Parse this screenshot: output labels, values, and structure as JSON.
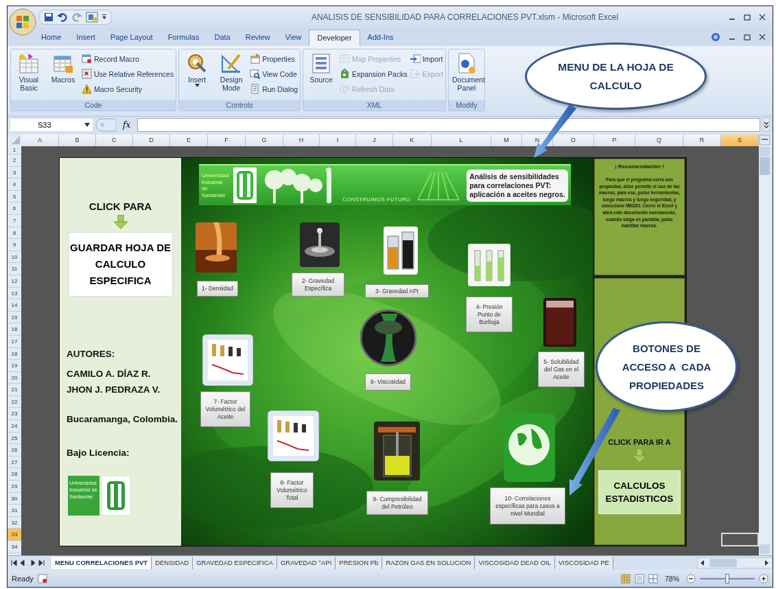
{
  "window": {
    "title": "ANALISIS DE SENSIBILIDAD PARA CORRELACIONES PVT.xlsm - Microsoft Excel"
  },
  "ribbon_tabs": [
    {
      "label": "Home",
      "selected": false
    },
    {
      "label": "Insert",
      "selected": false
    },
    {
      "label": "Page Layout",
      "selected": false
    },
    {
      "label": "Formulas",
      "selected": false
    },
    {
      "label": "Data",
      "selected": false
    },
    {
      "label": "Review",
      "selected": false
    },
    {
      "label": "View",
      "selected": false
    },
    {
      "label": "Developer",
      "selected": true
    },
    {
      "label": "Add-Ins",
      "selected": false
    }
  ],
  "ribbon_groups": [
    {
      "label": "Code",
      "items": [
        {
          "label": "Visual Basic",
          "kind": "large"
        },
        {
          "label": "Macros",
          "kind": "large"
        },
        {
          "label": "Record Macro",
          "kind": "small",
          "disabled": false
        },
        {
          "label": "Use Relative References",
          "kind": "small",
          "disabled": false
        },
        {
          "label": "Macro Security",
          "kind": "small",
          "disabled": false
        }
      ]
    },
    {
      "label": "Controls",
      "items": [
        {
          "label": "Insert",
          "kind": "dropdown"
        },
        {
          "label": "Design Mode",
          "kind": "large"
        },
        {
          "label": "Properties",
          "kind": "small",
          "disabled": false
        },
        {
          "label": "View Code",
          "kind": "small",
          "disabled": false
        },
        {
          "label": "Run Dialog",
          "kind": "small",
          "disabled": false
        }
      ]
    },
    {
      "label": "XML",
      "items": [
        {
          "label": "Source",
          "kind": "large"
        },
        {
          "label": "Map Properties",
          "kind": "small",
          "disabled": true
        },
        {
          "label": "Expansion Packs",
          "kind": "small",
          "disabled": false
        },
        {
          "label": "Refresh Data",
          "kind": "small",
          "disabled": true
        },
        {
          "label": "Import",
          "kind": "small",
          "disabled": false
        },
        {
          "label": "Export",
          "kind": "small",
          "disabled": true
        }
      ]
    },
    {
      "label": "Modify",
      "items": [
        {
          "label": "Document Panel",
          "kind": "large"
        }
      ]
    }
  ],
  "formula_bar": {
    "name_box": "S33",
    "function_label": "fx"
  },
  "columns": [
    {
      "label": "A",
      "selected": false
    },
    {
      "label": "B",
      "selected": false
    },
    {
      "label": "C",
      "selected": false
    },
    {
      "label": "D",
      "selected": false
    },
    {
      "label": "E",
      "selected": false
    },
    {
      "label": "F",
      "selected": false
    },
    {
      "label": "G",
      "selected": false
    },
    {
      "label": "H",
      "selected": false
    },
    {
      "label": "I",
      "selected": false
    },
    {
      "label": "J",
      "selected": false
    },
    {
      "label": "K",
      "selected": false
    },
    {
      "label": "L",
      "selected": false
    },
    {
      "label": "M",
      "selected": false
    },
    {
      "label": "N",
      "selected": false
    },
    {
      "label": "O",
      "selected": false
    },
    {
      "label": "P",
      "selected": false
    },
    {
      "label": "Q",
      "selected": false
    },
    {
      "label": "R",
      "selected": false
    },
    {
      "label": "S",
      "selected": true
    }
  ],
  "rows": [
    {
      "label": "1",
      "selected": false
    },
    {
      "label": "2",
      "selected": false
    },
    {
      "label": "3",
      "selected": false
    },
    {
      "label": "4",
      "selected": false
    },
    {
      "label": "5",
      "selected": false
    },
    {
      "label": "6",
      "selected": false
    },
    {
      "label": "7",
      "selected": false
    },
    {
      "label": "8",
      "selected": false
    },
    {
      "label": "9",
      "selected": false
    },
    {
      "label": "10",
      "selected": false
    },
    {
      "label": "11",
      "selected": false
    },
    {
      "label": "12",
      "selected": false
    },
    {
      "label": "13",
      "selected": false
    },
    {
      "label": "14",
      "selected": false
    },
    {
      "label": "15",
      "selected": false
    },
    {
      "label": "16",
      "selected": false
    },
    {
      "label": "17",
      "selected": false
    },
    {
      "label": "18",
      "selected": false
    },
    {
      "label": "19",
      "selected": false
    },
    {
      "label": "20",
      "selected": false
    },
    {
      "label": "21",
      "selected": false
    },
    {
      "label": "22",
      "selected": false
    },
    {
      "label": "23",
      "selected": false
    },
    {
      "label": "24",
      "selected": false
    },
    {
      "label": "25",
      "selected": false
    },
    {
      "label": "26",
      "selected": false
    },
    {
      "label": "27",
      "selected": false
    },
    {
      "label": "28",
      "selected": false
    },
    {
      "label": "29",
      "selected": false
    },
    {
      "label": "30",
      "selected": false
    },
    {
      "label": "31",
      "selected": false
    },
    {
      "label": "32",
      "selected": false
    },
    {
      "label": "33",
      "selected": true
    },
    {
      "label": "34",
      "selected": false
    }
  ],
  "left_panel": {
    "click_label": "CLICK PARA",
    "save_button": "GUARDAR HOJA DE CALCULO ESPECIFICA",
    "authors_heading": "AUTORES:",
    "authors": [
      "CAMILO A. DÍAZ R.",
      "JHON J. PEDRAZA V."
    ],
    "location": "Bucaramanga, Colombia.",
    "license": "Bajo Licencia:",
    "logo_text": "Universidad Industrial de Santander"
  },
  "banner": {
    "university": "Universidad Industrial de Santander",
    "motto": "CONSTRUIMOS FUTURO",
    "title": "Análisis de sensibilidades para correlaciones PVT: aplicación a aceites negros."
  },
  "property_buttons": [
    {
      "label": "1- Densidad"
    },
    {
      "label": "2- Gravedad Específica"
    },
    {
      "label": "3- Gravedad API"
    },
    {
      "label": "4- Presión Punto de Burbuja"
    },
    {
      "label": "5- Solubilidad del Gas en el Aceite"
    },
    {
      "label": "6- Viscosidad"
    },
    {
      "label": "7- Factor Volumétrico del Aceite"
    },
    {
      "label": "8- Factor Volumétrico Total"
    },
    {
      "label": "9- Compresibilidad del Petróleo"
    },
    {
      "label": "10- Correlaciones específicas para casos a nivel Mundial"
    }
  ],
  "recommendation": {
    "title": "¡ Recomendación !",
    "text": "Para que el programa corra con propiedad, debe permitir el uso de las macros, para eso, pulse herramientas, luego macros y luego seguridad, y seleccione MEDIO. Cierre el Excel y abra este documento nuevamente, cuando salga en pantalla, pulse habilitar macros."
  },
  "right_panel": {
    "click_label": "CLICK PARA IR A",
    "button": "CALCULOS ESTADISTICOS"
  },
  "callouts": [
    {
      "text": "MENU DE LA HOJA DE CALCULO"
    },
    {
      "text": "BOTONES DE ACCESO A  CADA PROPIEDADES"
    }
  ],
  "sheet_tabs": [
    {
      "label": "MENU CORRELACIONES PVT",
      "selected": true
    },
    {
      "label": "DENSIDAD",
      "selected": false
    },
    {
      "label": "GRAVEDAD ESPECIFICA",
      "selected": false
    },
    {
      "label": "GRAVEDAD °API",
      "selected": false
    },
    {
      "label": "PRESION Pb",
      "selected": false
    },
    {
      "label": "RAZON GAS EN SOLUCION",
      "selected": false
    },
    {
      "label": "VISCOSIDAD DEAD OIL",
      "selected": false
    },
    {
      "label": "VISCOSIDAD PE",
      "selected": false
    }
  ],
  "status_bar": {
    "status": "Ready",
    "zoom": "78%",
    "zoom_slider": {
      "level": 0.5
    }
  }
}
